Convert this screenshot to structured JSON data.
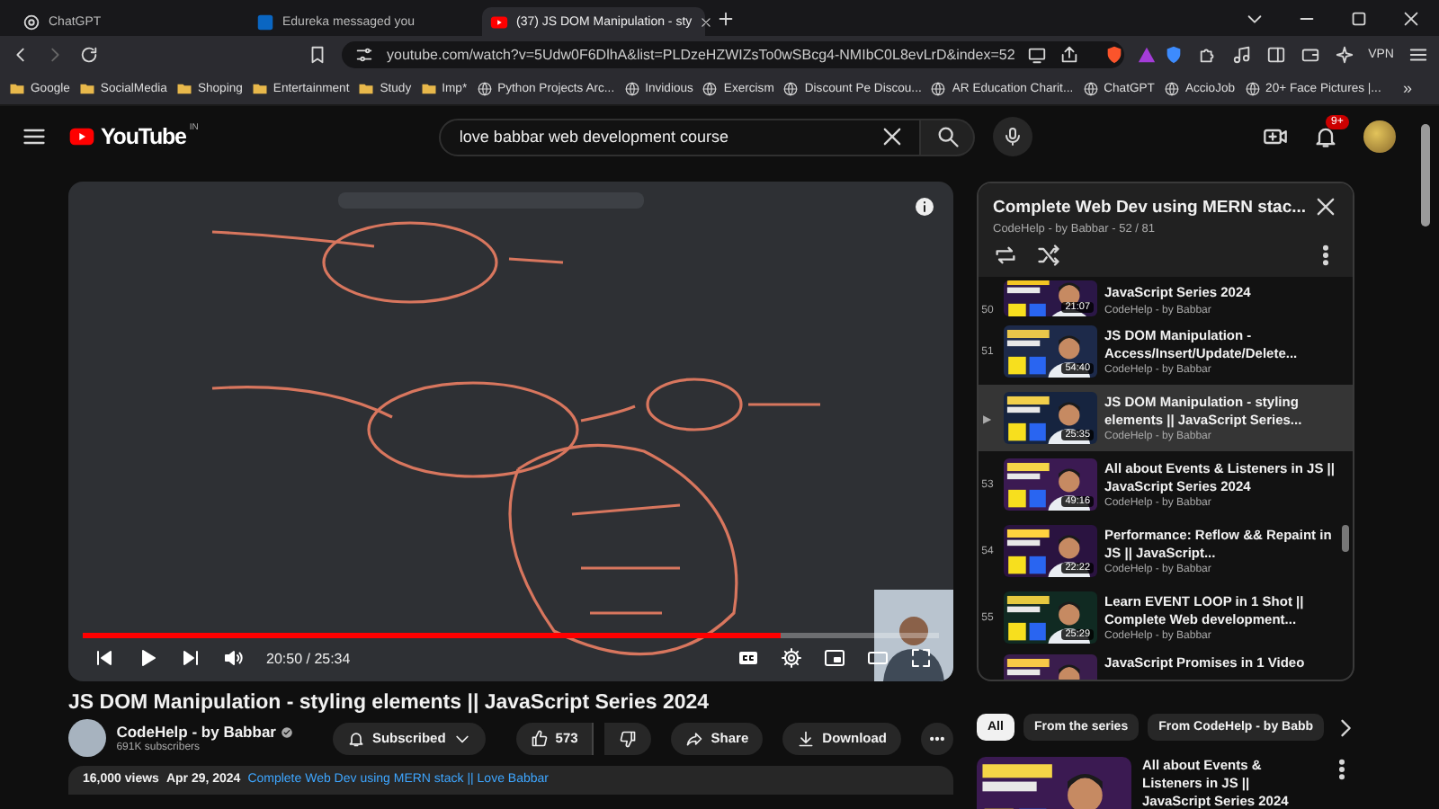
{
  "browser": {
    "tabs": [
      {
        "title": "ChatGPT",
        "kind": "ai",
        "selected": false
      },
      {
        "title": "Edureka messaged you",
        "kind": "social",
        "selected": false
      },
      {
        "title": "(37) JS DOM Manipulation - sty",
        "kind": "video",
        "selected": true
      }
    ],
    "url": "youtube.com/watch?v=5Udw0F6DlhA&list=PLDzeHZWIZsTo0wSBcg4-NMIbC0L8evLrD&index=52",
    "vpn": "VPN",
    "bookmarks": [
      {
        "label": "Google",
        "kind": "folder"
      },
      {
        "label": "SocialMedia",
        "kind": "folder"
      },
      {
        "label": "Shoping",
        "kind": "folder"
      },
      {
        "label": "Entertainment",
        "kind": "folder"
      },
      {
        "label": "Study",
        "kind": "folder"
      },
      {
        "label": "Imp*",
        "kind": "folder"
      },
      {
        "label": "Python Projects Arc...",
        "kind": "site"
      },
      {
        "label": "Invidious",
        "kind": "site"
      },
      {
        "label": "Exercism",
        "kind": "site"
      },
      {
        "label": "Discount Pe Discou...",
        "kind": "site"
      },
      {
        "label": "AR Education Charit...",
        "kind": "site"
      },
      {
        "label": "ChatGPT",
        "kind": "site"
      },
      {
        "label": "AccioJob",
        "kind": "site"
      },
      {
        "label": "20+ Face Pictures |...",
        "kind": "site"
      }
    ],
    "more": "»"
  },
  "header": {
    "logo": "YouTube",
    "country": "IN",
    "search": {
      "value": "love babbar web development course"
    },
    "notifications": "9+"
  },
  "player": {
    "time": "20:50 / 25:34",
    "progress": {
      "level": 0.815
    }
  },
  "playlist": {
    "title": "Complete Web Dev using MERN stac...",
    "subtitle": "CodeHelp - by Babbar - 52 / 81",
    "items": [
      {
        "index": "50",
        "title": "JavaScript Series 2024",
        "channel": "CodeHelp - by Babbar",
        "duration": "21:07",
        "selected": false
      },
      {
        "index": "51",
        "title": "JS DOM Manipulation - Access/Insert/Update/Delete...",
        "channel": "CodeHelp - by Babbar",
        "duration": "54:40",
        "selected": false
      },
      {
        "index": "▶",
        "title": "JS DOM Manipulation - styling elements || JavaScript Series...",
        "channel": "CodeHelp - by Babbar",
        "duration": "25:35",
        "selected": true
      },
      {
        "index": "53",
        "title": "All about Events & Listeners in JS || JavaScript Series 2024",
        "channel": "CodeHelp - by Babbar",
        "duration": "49:16",
        "selected": false
      },
      {
        "index": "54",
        "title": "Performance: Reflow && Repaint in JS || JavaScript...",
        "channel": "CodeHelp - by Babbar",
        "duration": "22:22",
        "selected": false
      },
      {
        "index": "55",
        "title": "Learn EVENT LOOP in 1 Shot || Complete Web development...",
        "channel": "CodeHelp - by Babbar",
        "duration": "25:29",
        "selected": false
      },
      {
        "title": "JavaScript Promises in 1 Video",
        "selected": false
      }
    ]
  },
  "video": {
    "title": "JS DOM Manipulation - styling elements || JavaScript Series 2024",
    "channel": "CodeHelp - by Babbar",
    "subscribers": "691K subscribers",
    "subscribe": "Subscribed",
    "likes": "573",
    "share": "Share",
    "download": "Download",
    "views": "16,000 views",
    "date": "Apr 29, 2024",
    "link": "Complete Web Dev using MERN stack || Love Babbar"
  },
  "chips": [
    {
      "label": "All",
      "selected": true
    },
    {
      "label": "From the series",
      "selected": false
    },
    {
      "label": "From CodeHelp - by Babb",
      "selected": false
    }
  ],
  "recommendations": [
    {
      "title": "All about Events & Listeners in JS || JavaScript Series 2024"
    }
  ]
}
